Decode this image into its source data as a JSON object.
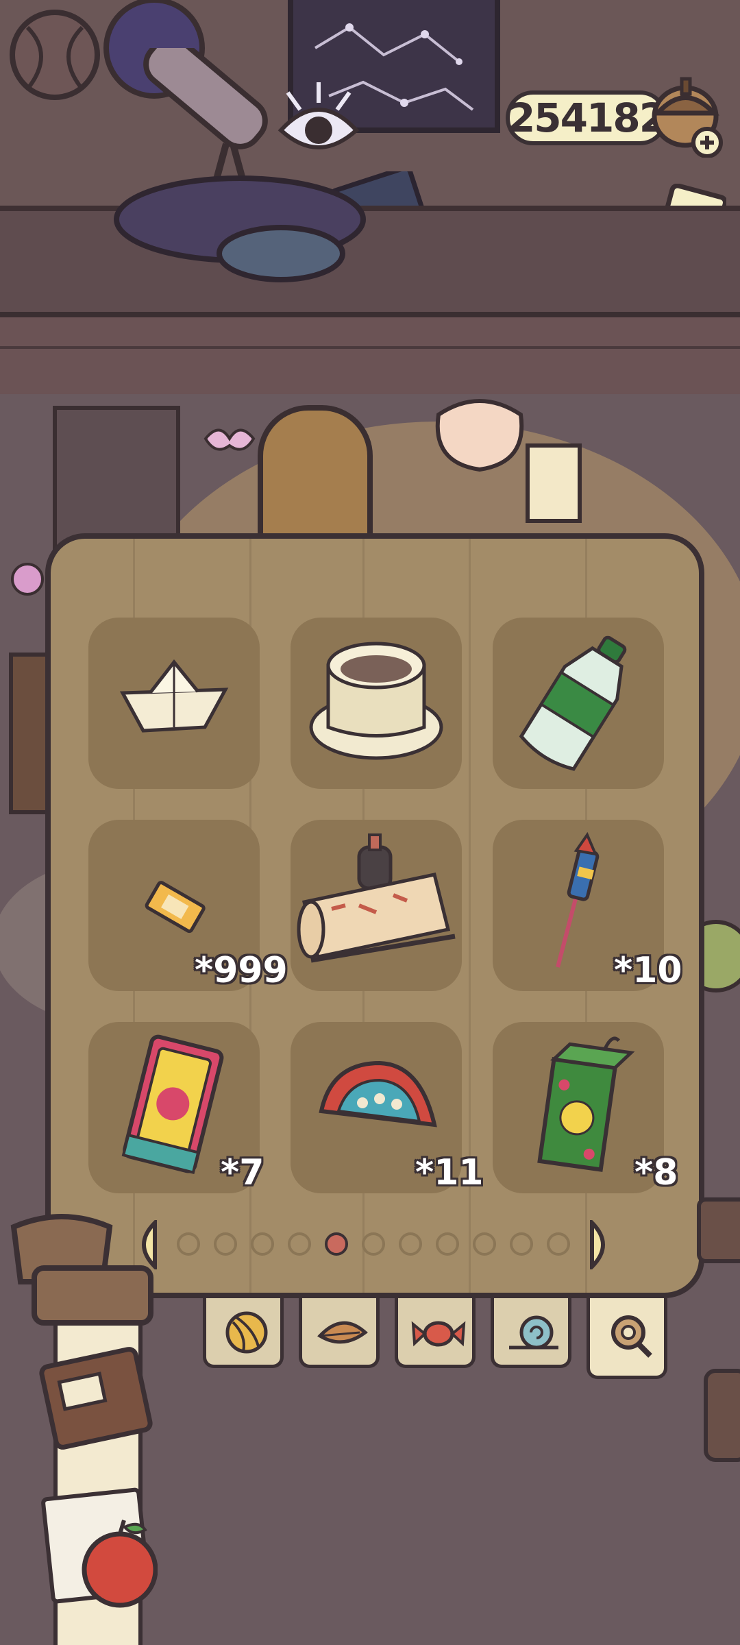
{
  "coins": "254182",
  "hud_icons": [
    "acorn-add-icon",
    "eye-view-icon",
    "card-icon"
  ],
  "inventory": {
    "slots": [
      {
        "item": "paper-boat-icon",
        "qty": ""
      },
      {
        "item": "teacup-icon",
        "qty": ""
      },
      {
        "item": "soda-bottle-icon",
        "qty": ""
      },
      {
        "item": "ticket-icon",
        "qty": "*999"
      },
      {
        "item": "craft-kit-icon",
        "qty": ""
      },
      {
        "item": "firework-rocket-icon",
        "qty": "*10"
      },
      {
        "item": "tarot-card-icon",
        "qty": "*7"
      },
      {
        "item": "fan-icon",
        "qty": "*11"
      },
      {
        "item": "juice-box-icon",
        "qty": "*8"
      }
    ],
    "page_count": 11,
    "current_page": 5
  },
  "tabs": [
    {
      "name": "yarn-tab-icon"
    },
    {
      "name": "leaf-tab-icon"
    },
    {
      "name": "candy-tab-icon"
    },
    {
      "name": "snail-tab-icon"
    },
    {
      "name": "search-tab-icon"
    }
  ],
  "colors": {
    "panel": "#a38c68",
    "slot": "#8d7654",
    "outline": "#3b3034",
    "active_dot": "#c96a5e"
  }
}
